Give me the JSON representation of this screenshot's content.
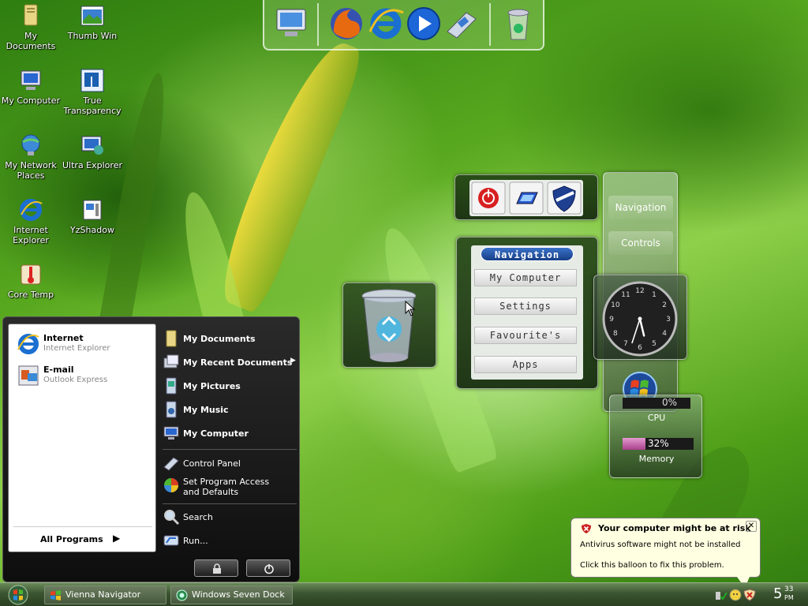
{
  "desktop": {
    "icons": [
      {
        "label": "My Documents",
        "icon": "folder-documents-icon"
      },
      {
        "label": "Thumb Win",
        "icon": "thumbnail-window-icon"
      },
      {
        "label": "My Computer",
        "icon": "computer-icon"
      },
      {
        "label": "True Transparency",
        "icon": "true-transparency-icon"
      },
      {
        "label": "My Network Places",
        "icon": "network-places-icon"
      },
      {
        "label": "Ultra Explorer",
        "icon": "ultra-explorer-icon"
      },
      {
        "label": "Internet Explorer",
        "icon": "internet-explorer-icon"
      },
      {
        "label": "YzShadow",
        "icon": "yzshadow-icon"
      },
      {
        "label": "Core Temp",
        "icon": "thermometer-icon"
      }
    ]
  },
  "dock": {
    "items": [
      "computer-icon",
      "firefox-icon",
      "internet-explorer-icon",
      "media-player-icon",
      "control-panel-icon",
      "recycle-bin-icon"
    ]
  },
  "gadgets": {
    "power_buttons": [
      "power-icon",
      "window-switch-icon",
      "shield-icon"
    ],
    "navigation": {
      "title": "Navigation",
      "buttons": [
        "My Computer",
        "Settings",
        "Favourite's",
        "Apps"
      ]
    },
    "vertical_panel": {
      "items": [
        "Navigation",
        "Controls"
      ]
    },
    "clock": {
      "numbers": [
        "12",
        "1",
        "2",
        "3",
        "4",
        "5",
        "6",
        "7",
        "8",
        "9",
        "10",
        "11"
      ]
    },
    "cpu": {
      "label": "CPU",
      "value_text": "0%",
      "value": 0
    },
    "memory": {
      "label": "Memory",
      "value_text": "32%",
      "value": 32
    }
  },
  "start_menu": {
    "pinned": [
      {
        "title": "Internet",
        "subtitle": "Internet Explorer",
        "icon": "internet-explorer-icon"
      },
      {
        "title": "E-mail",
        "subtitle": "Outlook Express",
        "icon": "outlook-express-icon"
      }
    ],
    "all_programs": "All Programs",
    "right_items": [
      {
        "label": "My Documents",
        "icon": "folder-documents-icon",
        "bold": true
      },
      {
        "label": "My Recent Documents",
        "icon": "recent-documents-icon",
        "bold": true,
        "arrow": true
      },
      {
        "label": "My Pictures",
        "icon": "pictures-icon",
        "bold": true
      },
      {
        "label": "My Music",
        "icon": "music-icon",
        "bold": true
      },
      {
        "label": "My Computer",
        "icon": "computer-icon",
        "bold": true
      },
      {
        "label": "Control Panel",
        "icon": "control-panel-icon"
      },
      {
        "label": "Set Program Access and Defaults",
        "icon": "program-access-icon"
      },
      {
        "label": "Search",
        "icon": "search-icon"
      },
      {
        "label": "Run...",
        "icon": "run-icon"
      }
    ]
  },
  "taskbar": {
    "buttons": [
      {
        "label": "Vienna Navigator",
        "icon": "vienna-navigator-icon"
      },
      {
        "label": "Windows Seven Dock",
        "icon": "seven-dock-icon"
      }
    ],
    "clock_hour": "5",
    "clock_minute": "33",
    "clock_ampm": "PM"
  },
  "balloon": {
    "title": "Your computer might be at risk",
    "line1": "Antivirus software might not be installed",
    "line2": "Click this balloon to fix this problem."
  },
  "colors": {
    "accent": "#2f7a10",
    "memory_bar": "#c060b0",
    "warning": "#cc2020"
  }
}
